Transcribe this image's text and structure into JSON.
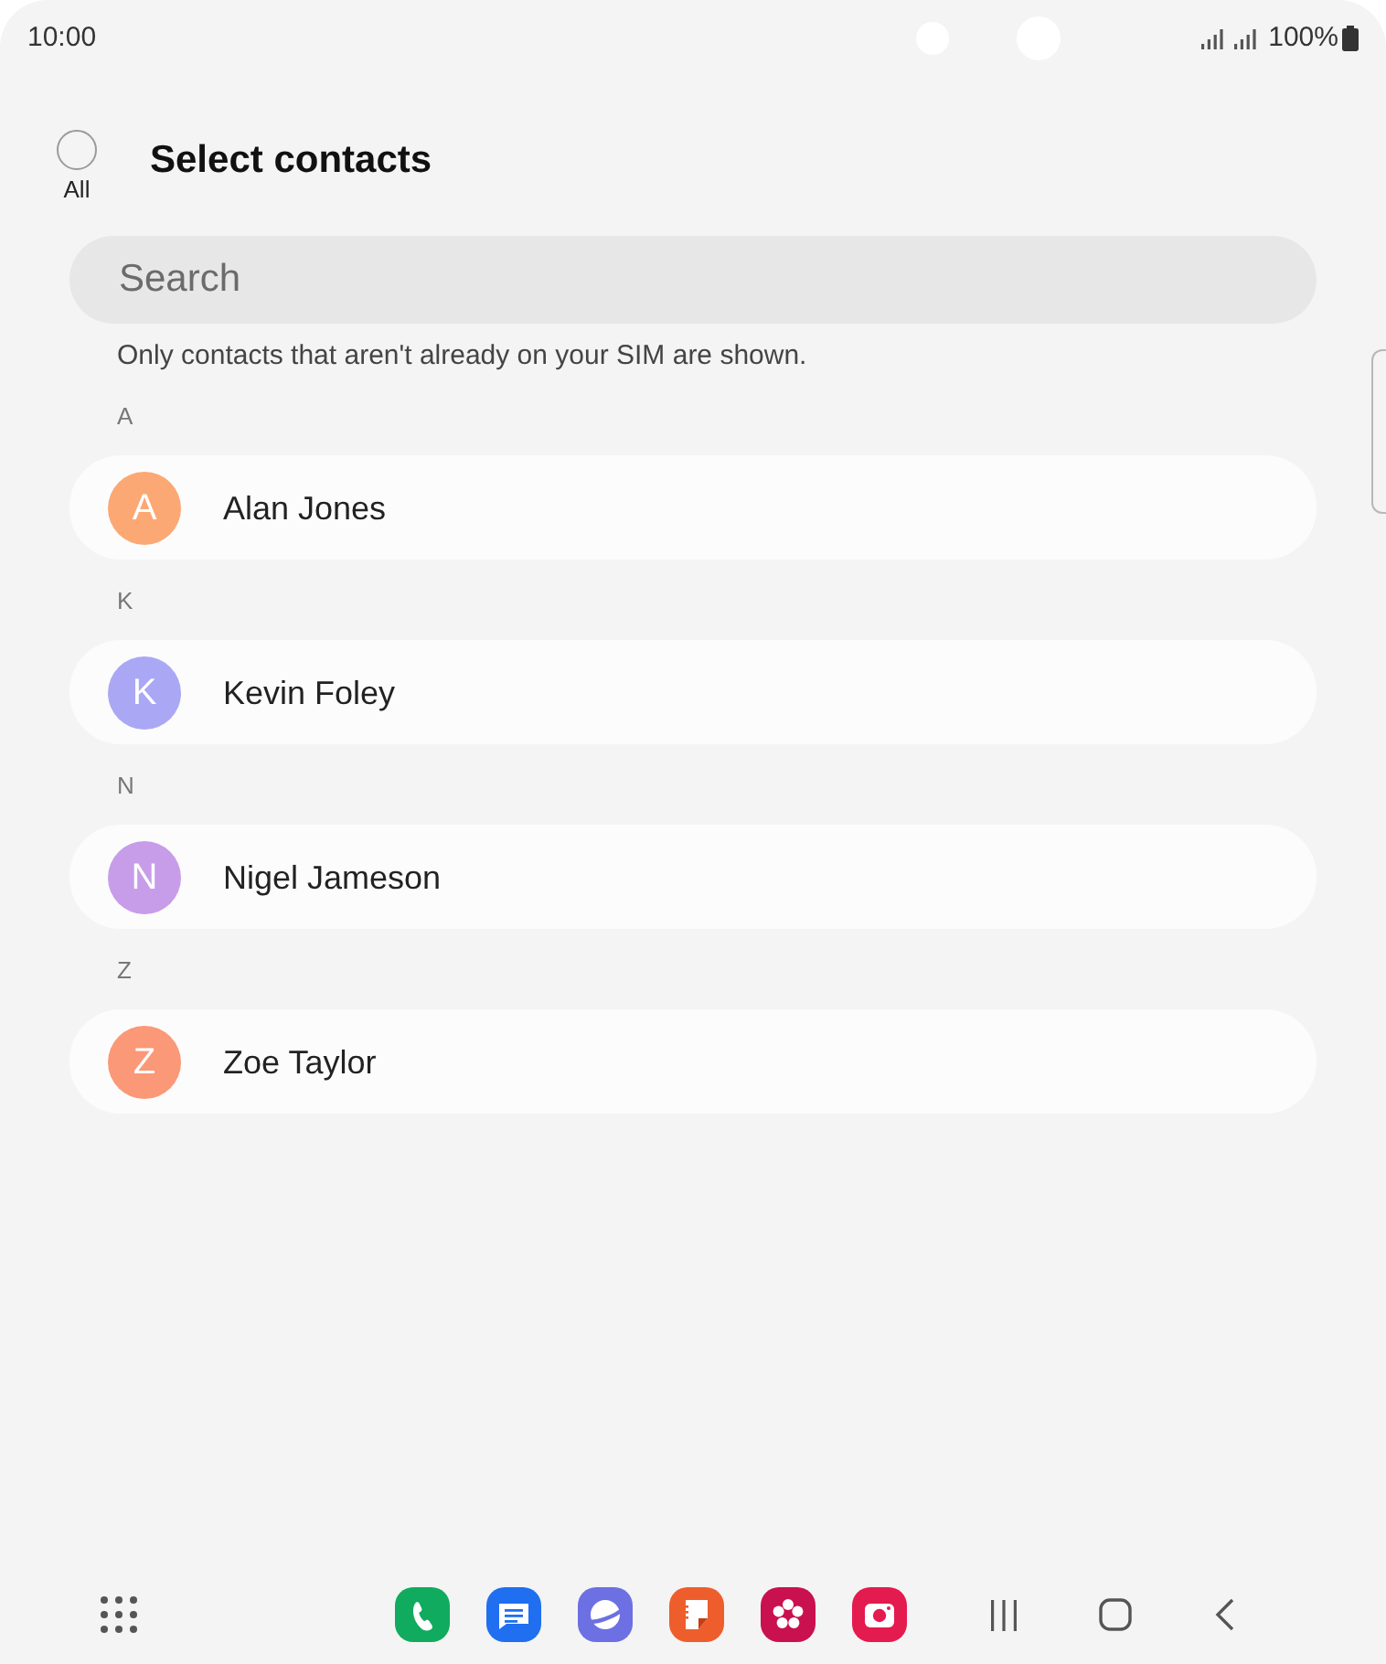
{
  "status_bar": {
    "time": "10:00",
    "battery_text": "100%"
  },
  "header": {
    "select_all": {
      "label": "All",
      "checked": false
    },
    "title": "Select contacts"
  },
  "search": {
    "placeholder": "Search"
  },
  "notice": "Only contacts that aren't already on your SIM are shown.",
  "sections": [
    {
      "letter": "A",
      "contacts": [
        {
          "initial": "A",
          "name": "Alan Jones",
          "color": "#fca874"
        }
      ]
    },
    {
      "letter": "K",
      "contacts": [
        {
          "initial": "K",
          "name": "Kevin Foley",
          "color": "#aaa8f4"
        }
      ]
    },
    {
      "letter": "N",
      "contacts": [
        {
          "initial": "N",
          "name": "Nigel Jameson",
          "color": "#c79de9"
        }
      ]
    },
    {
      "letter": "Z",
      "contacts": [
        {
          "initial": "Z",
          "name": "Zoe Taylor",
          "color": "#fb9877"
        }
      ]
    }
  ]
}
